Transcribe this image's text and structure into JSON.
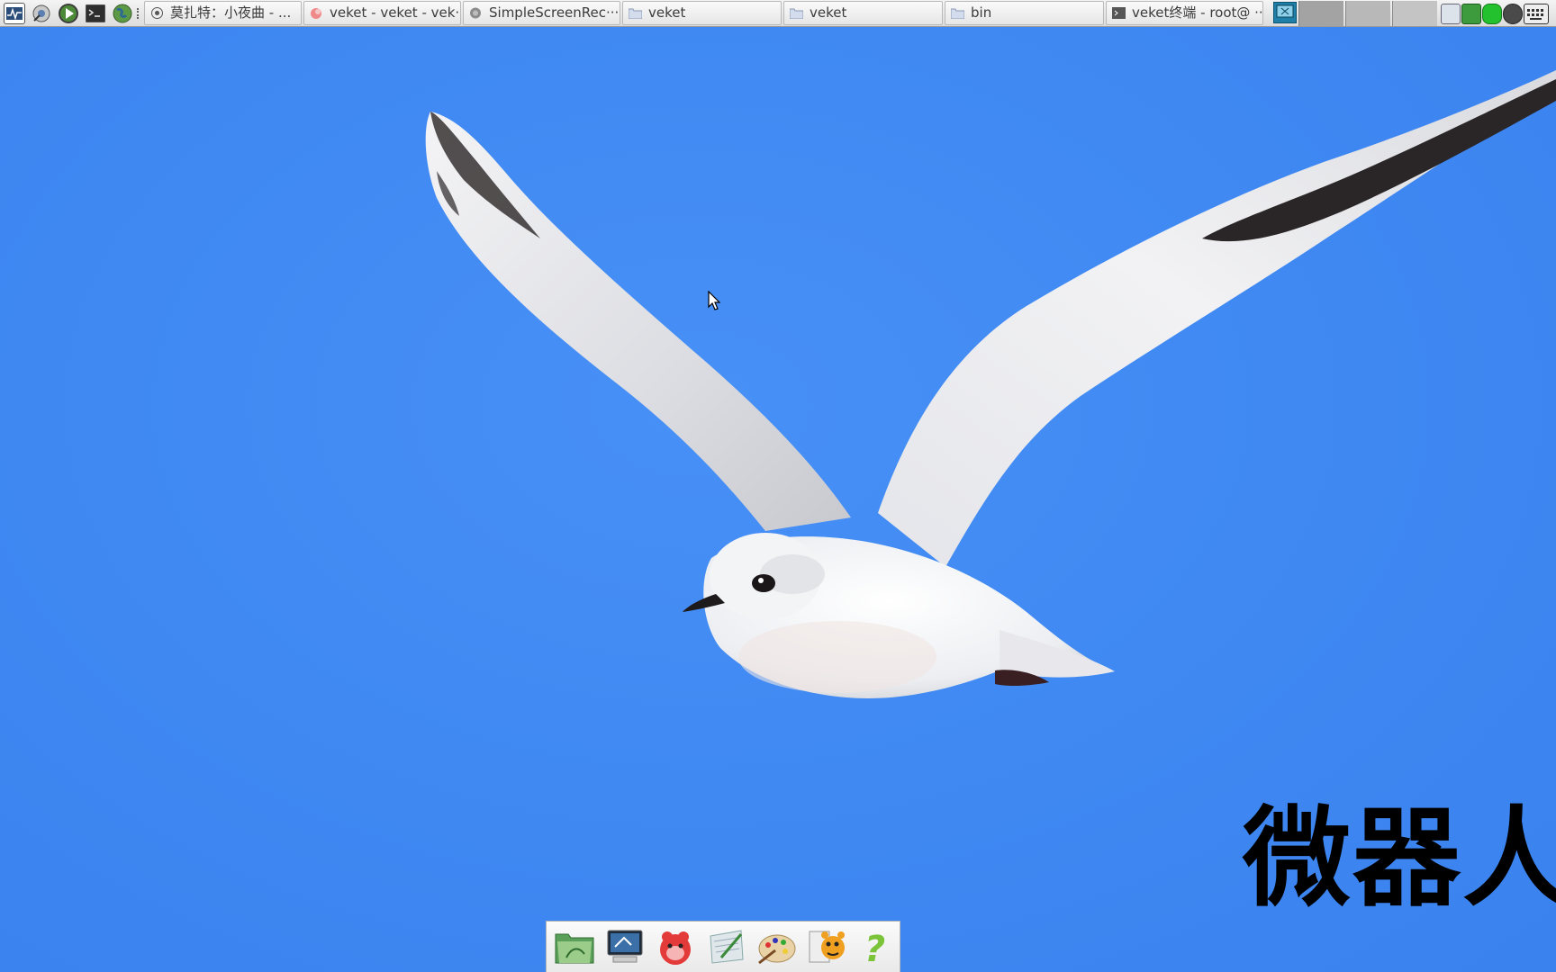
{
  "taskbar": {
    "launchers": [
      {
        "name": "system-monitor-icon"
      },
      {
        "name": "settings-wizard-icon"
      },
      {
        "name": "media-play-icon"
      },
      {
        "name": "terminal-icon"
      },
      {
        "name": "web-browser-icon"
      }
    ],
    "tasks": [
      {
        "label": "莫扎特：小夜曲 - ...",
        "icon": "media-player-icon"
      },
      {
        "label": "veket - veket - vek···",
        "icon": "browser-tab-icon"
      },
      {
        "label": "SimpleScreenRec···",
        "icon": "screen-recorder-icon"
      },
      {
        "label": "veket",
        "icon": "folder-icon"
      },
      {
        "label": "veket",
        "icon": "folder-icon"
      },
      {
        "label": "bin",
        "icon": "folder-icon"
      },
      {
        "label": "veket终端 - root@ ···",
        "icon": "terminal-icon"
      }
    ],
    "tray": [
      "show-desktop-icon",
      "network-icon",
      "shield-icon",
      "battery-icon",
      "power-icon",
      "keyboard-icon"
    ]
  },
  "desktop": {
    "overlay_text": "微器人",
    "colors": {
      "sky": "#3f87f2",
      "bird_body": "#f2f3f5",
      "wing_tip": "#2a2526"
    }
  },
  "dock": {
    "items": [
      {
        "name": "file-manager-icon"
      },
      {
        "name": "my-computer-icon"
      },
      {
        "name": "pet-mascot-icon"
      },
      {
        "name": "notepad-icon"
      },
      {
        "name": "paint-palette-icon"
      },
      {
        "name": "app-store-icon"
      },
      {
        "name": "help-icon"
      }
    ]
  }
}
